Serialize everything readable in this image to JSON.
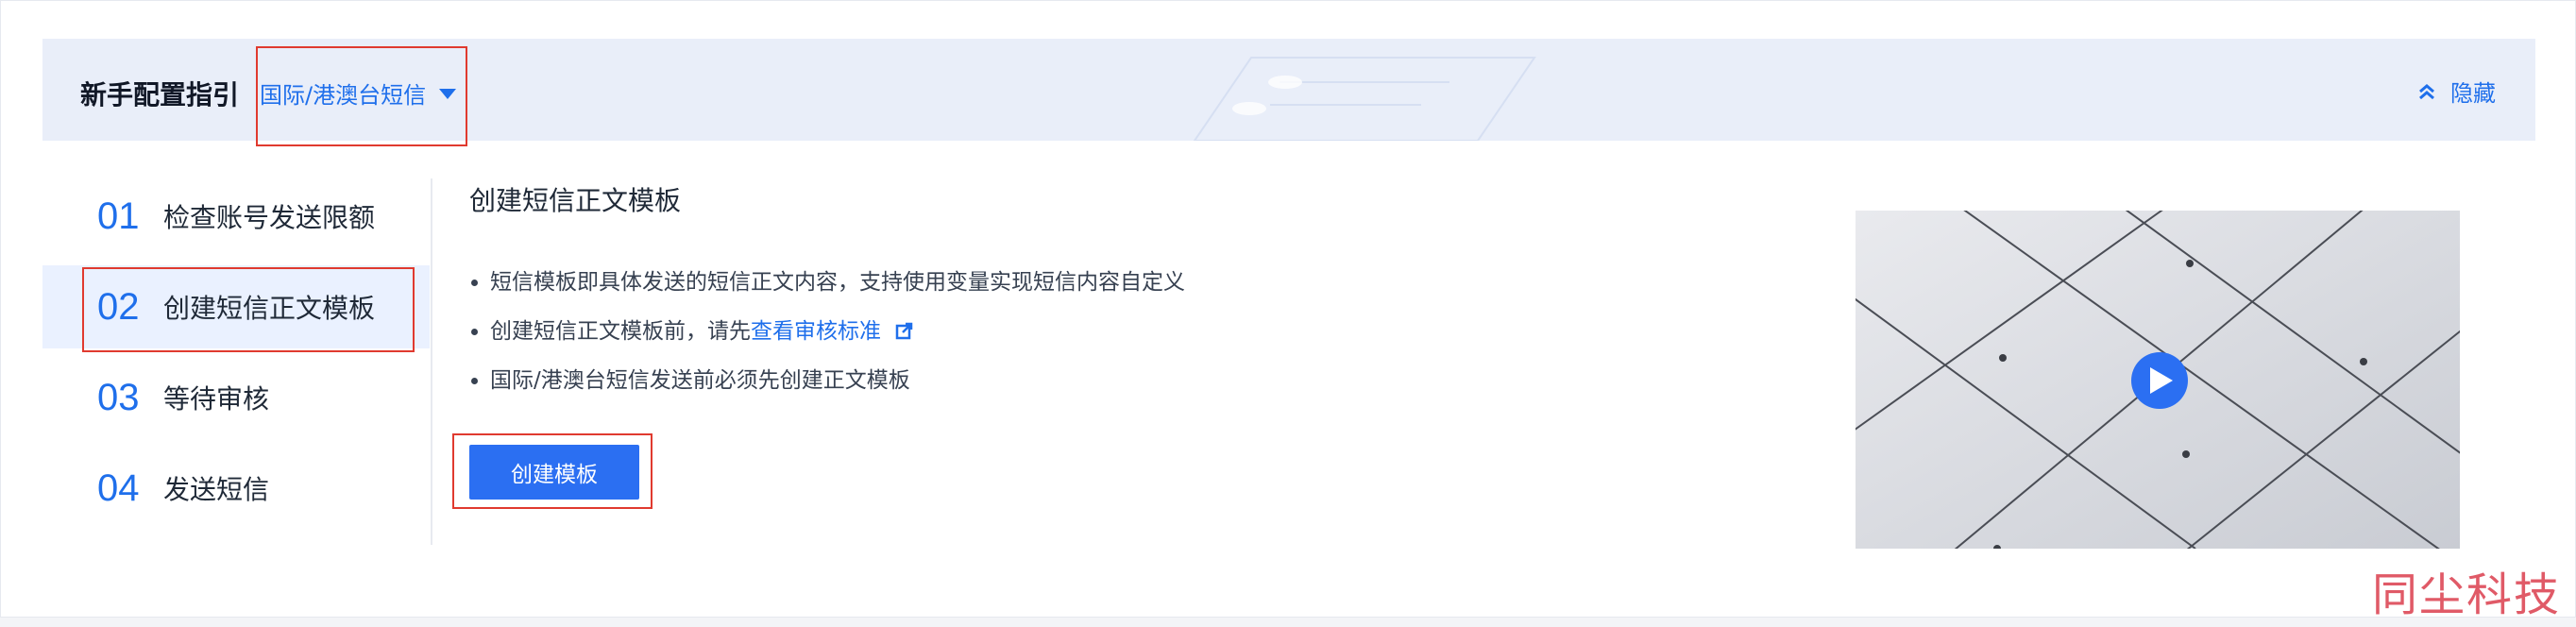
{
  "banner": {
    "title": "新手配置指引",
    "region_select": "国际/港澳台短信",
    "hide_label": "隐藏"
  },
  "steps": [
    {
      "num": "01",
      "label": "检查账号发送限额",
      "active": false
    },
    {
      "num": "02",
      "label": "创建短信正文模板",
      "active": true
    },
    {
      "num": "03",
      "label": "等待审核",
      "active": false
    },
    {
      "num": "04",
      "label": "发送短信",
      "active": false
    }
  ],
  "main": {
    "title": "创建短信正文模板",
    "bullets": {
      "b1": "短信模板即具体发送的短信正文内容，支持使用变量实现短信内容自定义",
      "b2_prefix": "创建短信正文模板前，请先",
      "b2_link": "查看审核标准",
      "b3": "国际/港澳台短信发送前必须先创建正文模板"
    },
    "create_button": "创建模板"
  },
  "watermark": "同尘科技",
  "colors": {
    "accent": "#1f6feb",
    "button": "#2b6ff2",
    "annotation": "#e03a2f",
    "banner_bg": "#e9eef9"
  },
  "icons": {
    "caret": "caret-down-icon",
    "hide": "double-chevron-up-icon",
    "external": "external-link-icon",
    "play": "play-icon"
  }
}
